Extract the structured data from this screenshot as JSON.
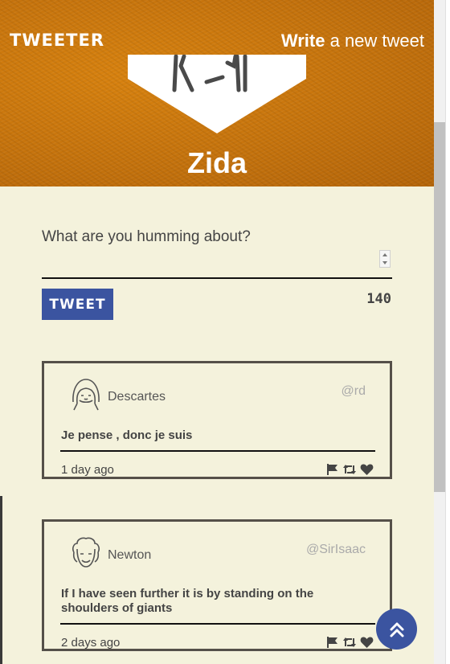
{
  "header": {
    "brand": "TWEETER",
    "nav_write_strong": "Write",
    "nav_write_rest": " a new tweet"
  },
  "profile": {
    "name": "Zida"
  },
  "composer": {
    "placeholder": "What are you humming about?",
    "button_label": "TWEET",
    "char_count": "140"
  },
  "tweets": [
    {
      "name": "Descartes",
      "handle": "@rd",
      "text": "Je pense , donc je suis",
      "time": "1 day ago"
    },
    {
      "name": "Newton",
      "handle": "@SirIsaac",
      "text": "If I have seen further it is by standing on the shoulders of giants",
      "time": "2 days ago"
    }
  ],
  "icons": {
    "flag": "flag-icon",
    "retweet": "retweet-icon",
    "like": "heart-icon",
    "scroll_top": "double-chevron-up-icon"
  },
  "colors": {
    "header_bg": "#c8760e",
    "page_bg": "#f4f2dc",
    "accent": "#3b54a0",
    "card_border": "#555049"
  }
}
